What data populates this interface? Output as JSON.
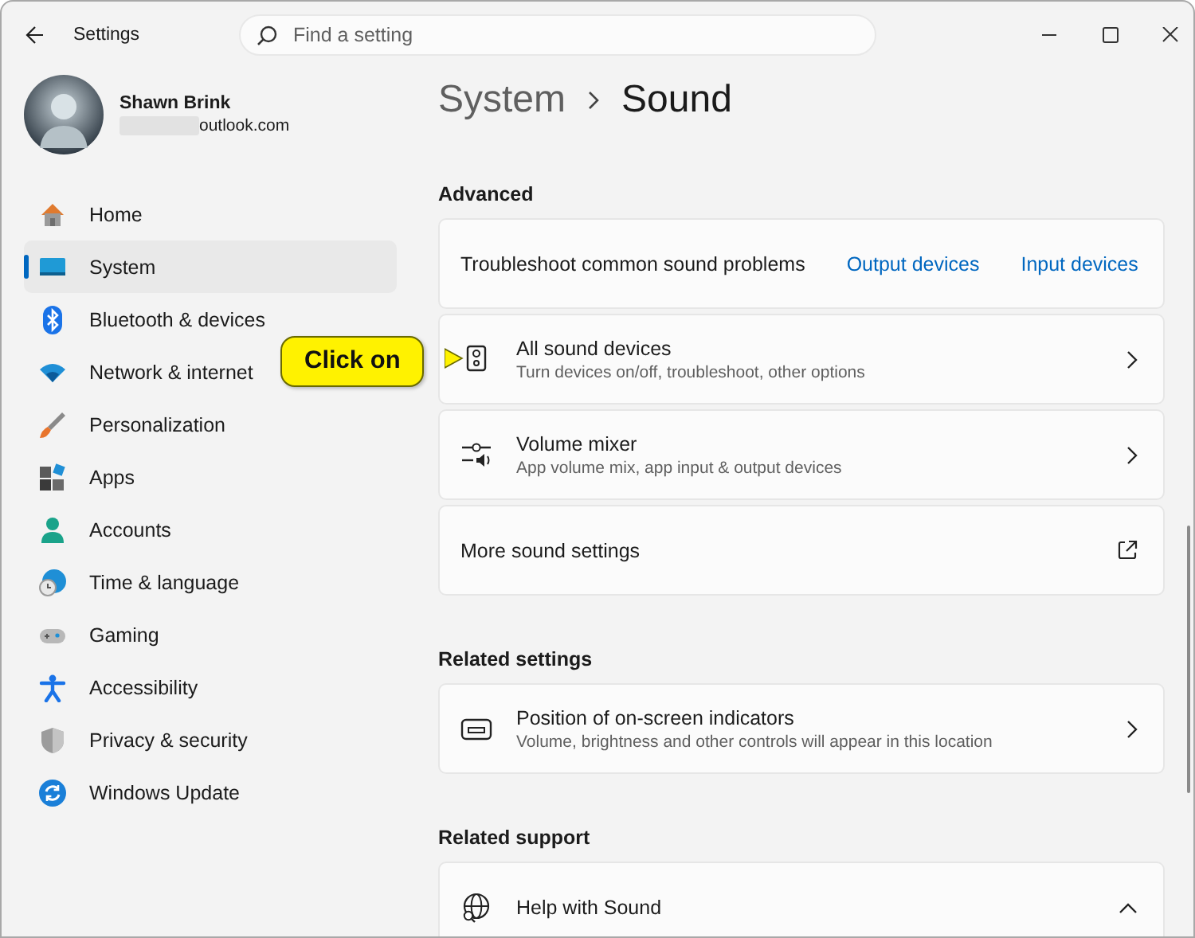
{
  "window": {
    "title": "Settings"
  },
  "search": {
    "placeholder": "Find a setting"
  },
  "user": {
    "name": "Shawn Brink",
    "email": "outlook.com"
  },
  "sidebar": {
    "items": [
      {
        "label": "Home",
        "selected": false
      },
      {
        "label": "System",
        "selected": true
      },
      {
        "label": "Bluetooth & devices",
        "selected": false
      },
      {
        "label": "Network & internet",
        "selected": false
      },
      {
        "label": "Personalization",
        "selected": false
      },
      {
        "label": "Apps",
        "selected": false
      },
      {
        "label": "Accounts",
        "selected": false
      },
      {
        "label": "Time & language",
        "selected": false
      },
      {
        "label": "Gaming",
        "selected": false
      },
      {
        "label": "Accessibility",
        "selected": false
      },
      {
        "label": "Privacy & security",
        "selected": false
      },
      {
        "label": "Windows Update",
        "selected": false
      }
    ]
  },
  "breadcrumb": [
    "System",
    "Sound"
  ],
  "sections": [
    {
      "heading": "Advanced",
      "cards": [
        {
          "kind": "links",
          "title": "Troubleshoot common sound problems",
          "links": [
            "Output devices",
            "Input devices"
          ]
        },
        {
          "kind": "chevron",
          "title": "All sound devices",
          "subtitle": "Turn devices on/off, troubleshoot, other options"
        },
        {
          "kind": "chevron",
          "title": "Volume mixer",
          "subtitle": "App volume mix, app input & output devices"
        },
        {
          "kind": "external",
          "title": "More sound settings"
        }
      ]
    },
    {
      "heading": "Related settings",
      "cards": [
        {
          "kind": "chevron",
          "title": "Position of on-screen indicators",
          "subtitle": "Volume, brightness and other controls will appear in this location"
        }
      ]
    },
    {
      "heading": "Related support",
      "cards": [
        {
          "kind": "expander",
          "title": "Help with Sound",
          "expanded": true
        }
      ]
    }
  ],
  "callout": {
    "text": "Click on"
  }
}
